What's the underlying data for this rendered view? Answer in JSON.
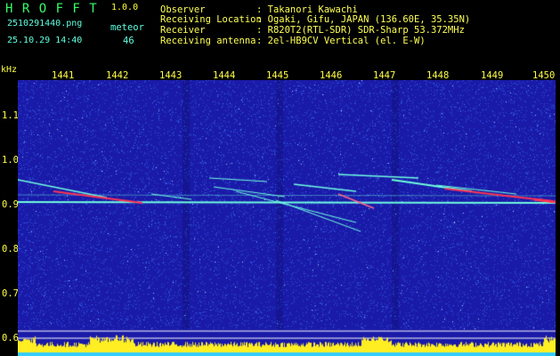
{
  "header": {
    "app_title": "H R O F F T",
    "version": "1.0.0",
    "filename": "2510291440.png",
    "mode_label": "meteor",
    "datetime": "25.10.29 14:40",
    "count": "46",
    "info": [
      {
        "label": "Observer",
        "value": ": Takanori Kawachi"
      },
      {
        "label": "Receiving Location",
        "value": ": Ogaki, Gifu, JAPAN (136.60E, 35.35N)"
      },
      {
        "label": "Receiver",
        "value": ": R820T2(RTL-SDR) SDR-Sharp 53.372MHz"
      },
      {
        "label": "Receiving antenna",
        "value": ": 2el-HB9CV Vertical (el. E-W)"
      }
    ]
  },
  "spectrogram": {
    "y_unit": "kHz",
    "x_ticks": [
      "1441",
      "1442",
      "1443",
      "1444",
      "1445",
      "1446",
      "1447",
      "1448",
      "1449",
      "1450"
    ],
    "y_ticks": [
      "1.1",
      "1.0",
      "0.9",
      "0.8",
      "0.7",
      "0.6"
    ],
    "colors": {
      "background": "#1a1aa8",
      "noise": "#3a7cff",
      "carrier": "#6fffe0",
      "hot": "#ff3355",
      "power_bar": "#ffee22",
      "power_base": "#33ccff"
    }
  }
}
